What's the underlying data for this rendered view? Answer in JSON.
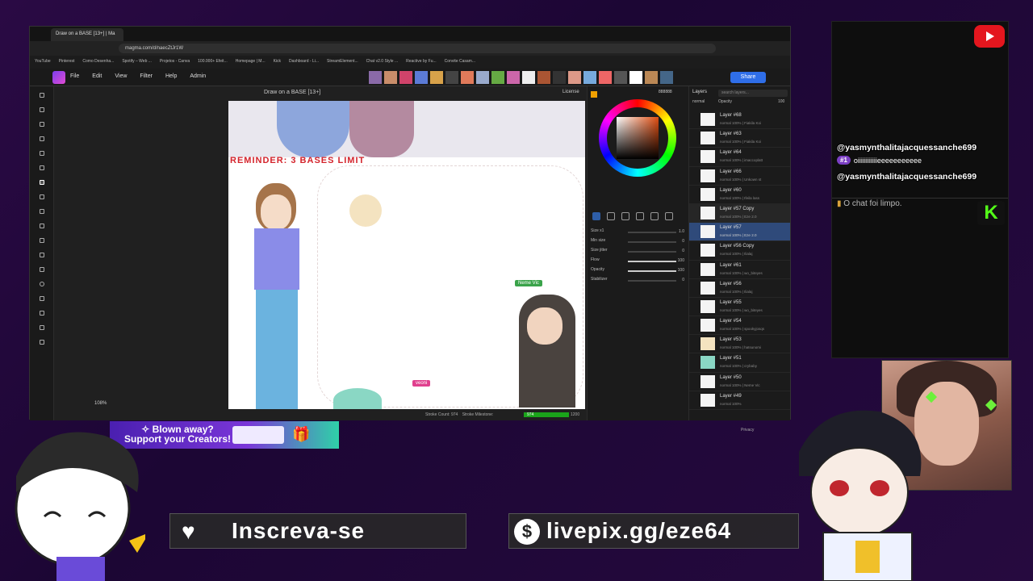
{
  "browser": {
    "tab_title": "Draw on a BASE [13+] | Ma",
    "url": "magma.com/d/naecZtJr1W",
    "bookmarks": [
      "YouTube",
      "Pinterest",
      "Como Desenha...",
      "Spotify – Web ...",
      "Projetos - Canva",
      "100.000+ Efeit...",
      "Homepage | M...",
      "Kick",
      "Dashboard - Li...",
      "StreamElement...",
      "Chat v2.0 Style ...",
      "Reactive by Fu...",
      "Convite Casam..."
    ]
  },
  "app": {
    "menu": [
      "File",
      "Edit",
      "View",
      "Filter",
      "Help",
      "Admin"
    ],
    "share_label": "Share",
    "doc_title": "Draw on a BASE [13+]",
    "license_label": "License",
    "zoom": "108%",
    "stroke_count_label": "Stroke Count: 974",
    "stroke_milestone_label": "Stroke Milestone:",
    "milestone_value": "974",
    "milestone_max": "1200",
    "canvas_reminder": "REMINDER: 3 BASES LIMIT",
    "collab_cursor_1": "Neme Vic",
    "collab_cursor_2": "veoni",
    "privacy": "Privacy"
  },
  "color_panel": {
    "hex": "888888",
    "brush": [
      {
        "label": "Size x1",
        "value": "1.0"
      },
      {
        "label": "Min size",
        "value": "0"
      },
      {
        "label": "Size jitter",
        "value": "0"
      },
      {
        "label": "Flow",
        "value": "100"
      },
      {
        "label": "Opacity",
        "value": "100"
      },
      {
        "label": "Stabilizer",
        "value": "0"
      }
    ]
  },
  "layers": {
    "title": "Layers",
    "search_placeholder": "search layers...",
    "blend": "normal",
    "opacity_label": "Opacity",
    "opacity_value": "100",
    "items": [
      {
        "name": "Layer #68",
        "sub": "normal 100% | Fiakila Koi"
      },
      {
        "name": "Layer #63",
        "sub": "normal 100% | Fiakila Koi"
      },
      {
        "name": "Layer #64",
        "sub": "normal 100% | imaccoplatt"
      },
      {
        "name": "Layer #66",
        "sub": "normal 100% | Unkown st"
      },
      {
        "name": "Layer #60",
        "sub": "normal 100% | Ifeila lass"
      },
      {
        "name": "Layer #57 Copy",
        "sub": "normal 100% | Eze 2.0"
      },
      {
        "name": "Layer #57",
        "sub": "normal 100% | Eze 2.0"
      },
      {
        "name": "Layer #56 Copy",
        "sub": "normal 100% | Ilialaj"
      },
      {
        "name": "Layer #61",
        "sub": "normal 100% | wo_biteyes"
      },
      {
        "name": "Layer #56",
        "sub": "normal 100% | Ilialaj"
      },
      {
        "name": "Layer #55",
        "sub": "normal 100% | wo_biteyes"
      },
      {
        "name": "Layer #54",
        "sub": "normal 100% | spookyjosqs"
      },
      {
        "name": "Layer #53",
        "sub": "normal 100% | hatsunomi"
      },
      {
        "name": "Layer #51",
        "sub": "normal 100% | crybaby"
      },
      {
        "name": "Layer #50",
        "sub": "normal 100% | Neme Vic"
      },
      {
        "name": "Layer #49",
        "sub": "normal 100%"
      }
    ]
  },
  "chat": {
    "user1": "@yasmynthalitajacquessanche699",
    "badge": "#1",
    "message": "oiiiiiiiiiiiieeeeeeeeeee",
    "user2": "@yasmynthalitajacquessanche699",
    "system": "O chat foi limpo.",
    "kick_letter": "K"
  },
  "promo": {
    "line1": "✧ Blown away?",
    "line2": "Support your Creators!"
  },
  "banners": {
    "subscribe": "Inscreva-se",
    "livepix": "livepix.gg/eze64"
  }
}
